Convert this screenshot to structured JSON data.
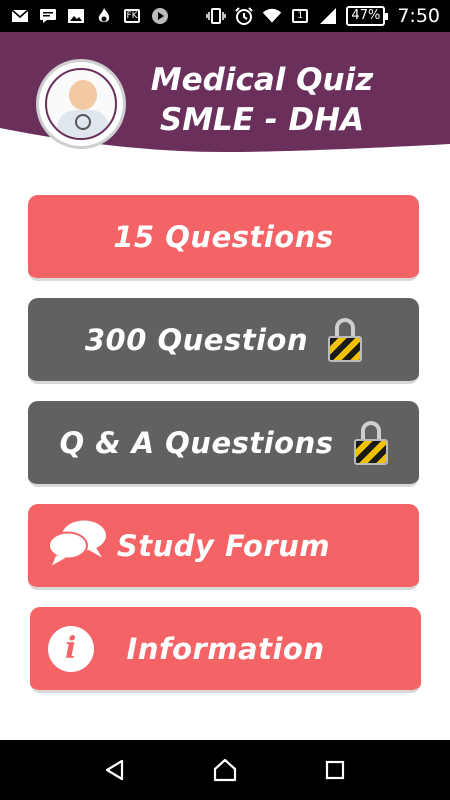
{
  "status_bar": {
    "icons": [
      "email-icon",
      "message-icon",
      "image-icon",
      "flame-icon",
      "fk-icon",
      "play-icon",
      "vibrate-icon",
      "alarm-icon",
      "wifi-icon",
      "sim-icon",
      "signal-icon",
      "battery-icon"
    ],
    "fk_label": "FK",
    "sim_label": "1",
    "battery": "47%",
    "time": "7:50"
  },
  "header": {
    "title_line1": "Medical Quiz",
    "title_line2": "SMLE - DHA",
    "background_color": "#6a2f5b"
  },
  "menu": {
    "items": [
      {
        "label": "15 Questions",
        "locked": false,
        "style": "red"
      },
      {
        "label": "300 Question",
        "locked": true,
        "style": "gray"
      },
      {
        "label": "Q & A Questions",
        "locked": true,
        "style": "gray"
      },
      {
        "label": "Study Forum",
        "icon": "chat-bubbles-icon",
        "style": "red"
      },
      {
        "label": "Information",
        "icon": "info-icon",
        "style": "red"
      }
    ]
  },
  "colors": {
    "accent_red": "#f46366",
    "locked_gray": "#616161",
    "header_purple": "#6a2f5b"
  },
  "nav_bar": {
    "items": [
      "back-icon",
      "home-icon",
      "recents-icon"
    ]
  }
}
